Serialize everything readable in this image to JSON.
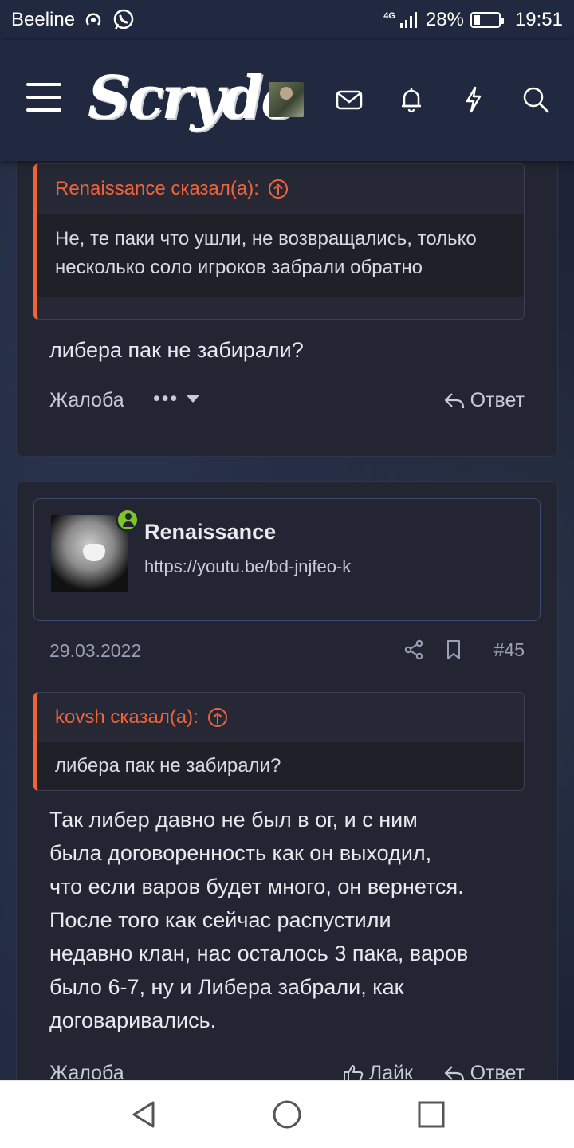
{
  "status_bar": {
    "carrier": "Beeline",
    "network": "4G",
    "battery": "28%",
    "battery_level": 0.28,
    "time": "19:51"
  },
  "header": {
    "logo": "Scryde",
    "icons": [
      "menu-icon",
      "avatar",
      "mail-icon",
      "bell-icon",
      "bolt-icon",
      "search-icon"
    ]
  },
  "post1": {
    "quote_author": "Renaissance сказал(а):",
    "quote_text": "Не, те паки что ушли, не возвращались, только несколько соло игроков забрали обратно",
    "text": "либера пак не забирали?",
    "report_label": "Жалоба",
    "more_label": "•••",
    "reply_label": "Ответ"
  },
  "post2": {
    "username": "Renaissance",
    "user_title": "https://youtu.be/bd-jnjfeo-k",
    "date": "29.03.2022",
    "post_number": "#45",
    "quote_author": "kovsh сказал(а):",
    "quote_text": "либера пак не забирали?",
    "text_lines": [
      "Так либер давно не был в ог, и с ним",
      "была договоренность как он выходил,",
      "что если варов будет много, он вернется.",
      "После того как сейчас распустили",
      "недавно клан, нас осталось 3 пака, варов",
      "было 6-7, ну и Либера забрали, как",
      "договаривались."
    ],
    "report_label": "Жалоба",
    "like_label": "Лайк",
    "reply_label": "Ответ"
  },
  "colors": {
    "accent_orange": "#f0643c",
    "online_green": "#7cc52a",
    "header_bg": "#212940",
    "card_bg": "#232632"
  }
}
